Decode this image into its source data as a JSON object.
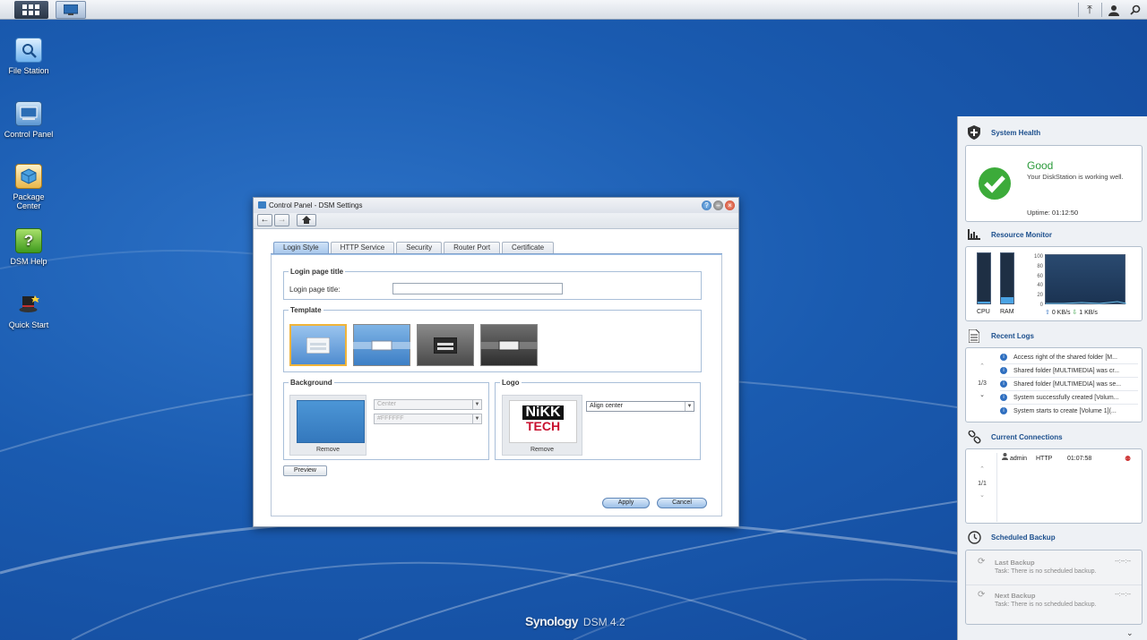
{
  "desktop": {
    "icons": [
      {
        "label": "File Station"
      },
      {
        "label": "Control Panel"
      },
      {
        "label": "Package Center"
      },
      {
        "label": "DSM Help"
      },
      {
        "label": "Quick Start"
      }
    ],
    "brand": "Synology",
    "version": "DSM 4.2"
  },
  "window": {
    "title": "Control Panel - DSM Settings",
    "tabs": [
      {
        "label": "Login Style",
        "active": true
      },
      {
        "label": "HTTP Service"
      },
      {
        "label": "Security"
      },
      {
        "label": "Router Port"
      },
      {
        "label": "Certificate"
      }
    ],
    "login_title_section": {
      "legend": "Login page title",
      "label": "Login page title:",
      "value": ""
    },
    "template_section": {
      "legend": "Template"
    },
    "background_section": {
      "legend": "Background",
      "remove_label": "Remove",
      "position_value": "Center",
      "color_value": "#FFFFFF",
      "preview_color": "#3b8bd0"
    },
    "logo_section": {
      "legend": "Logo",
      "logo_line1": "NiKK",
      "logo_line2": "TECH",
      "remove_label": "Remove",
      "align_value": "Align center"
    },
    "preview_label": "Preview",
    "apply_label": "Apply",
    "cancel_label": "Cancel"
  },
  "panel": {
    "system_health": {
      "title": "System Health",
      "status": "Good",
      "message": "Your DiskStation is working well.",
      "uptime": "Uptime: 01:12:50",
      "status_color": "#2a9a3a"
    },
    "resource_monitor": {
      "title": "Resource Monitor",
      "cpu_label": "CPU",
      "ram_label": "RAM",
      "cpu_usage": 0.03,
      "ram_usage": 0.12,
      "y_ticks": [
        "100",
        "80",
        "60",
        "40",
        "20",
        "0"
      ],
      "upload": "0 KB/s",
      "download": "1 KB/s"
    },
    "recent_logs": {
      "title": "Recent Logs",
      "page": "1/3",
      "items": [
        "Access right of the shared folder [M...",
        "Shared folder [MULTIMEDIA] was cr...",
        "Shared folder [MULTIMEDIA] was se...",
        "System successfully created [Volum...",
        "System starts to create [Volume 1](..."
      ]
    },
    "connections": {
      "title": "Current Connections",
      "page": "1/1",
      "rows": [
        {
          "user": "admin",
          "type": "HTTP",
          "time": "01:07:58"
        }
      ]
    },
    "scheduled_backup": {
      "title": "Scheduled Backup",
      "last_title": "Last Backup",
      "last_task": "Task: There is no scheduled backup.",
      "last_time": "--:--:--",
      "next_title": "Next Backup",
      "next_task": "Task: There is no scheduled backup.",
      "next_time": "--:--:--"
    }
  }
}
